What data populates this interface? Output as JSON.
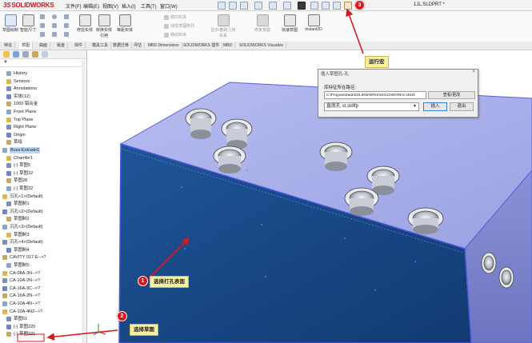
{
  "titlebar": {
    "brand": "SOLIDWORKS",
    "menus": [
      "文件(F)",
      "编辑(E)",
      "视图(V)",
      "插入(I)",
      "工具(T)",
      "窗口(W)"
    ],
    "document_title": "1JL.SLDPRT *"
  },
  "ribbon": {
    "buttons": [
      "草图绘制",
      "智能尺寸",
      "转换实体引用",
      "等距实体",
      "修剪实体",
      "显示/删除几何关系",
      "修复草图",
      "快速草图",
      "Instant2D"
    ],
    "small_buttons": [
      "镜向实体",
      "线性草图阵列",
      "移动实体"
    ]
  },
  "tabs": [
    "特征",
    "草图",
    "曲面",
    "钣金",
    "焊件",
    "模具工具",
    "数据迁移",
    "评估",
    "MBD Dimensions",
    "SOLIDWORKS 插件",
    "MBD",
    "SOLIDWORKS Visualize"
  ],
  "tree": {
    "filter_icon": "filter-icon",
    "items": [
      {
        "label": "History",
        "indent": 1
      },
      {
        "label": "Sensors",
        "indent": 1
      },
      {
        "label": "Annotations",
        "indent": 1
      },
      {
        "label": "实体(12)",
        "indent": 1
      },
      {
        "label": "1060 铝合金",
        "indent": 1
      },
      {
        "label": "Front Plane",
        "indent": 1
      },
      {
        "label": "Top Plane",
        "indent": 1
      },
      {
        "label": "Right Plane",
        "indent": 1
      },
      {
        "label": "Origin",
        "indent": 1
      },
      {
        "label": "草绘",
        "indent": 1
      },
      {
        "label": "Boss-Extrude1",
        "indent": 0,
        "selected": true
      },
      {
        "label": "Chamfer1",
        "indent": 1
      },
      {
        "label": "(-) 草图5",
        "indent": 1
      },
      {
        "label": "(-) 草图32",
        "indent": 1
      },
      {
        "label": "草图28",
        "indent": 1
      },
      {
        "label": "(-) 草图32",
        "indent": 1
      },
      {
        "label": "沉孔<1>(Default)",
        "indent": 0
      },
      {
        "label": "草图制1",
        "indent": 1
      },
      {
        "label": "沉孔<2>(Default)",
        "indent": 0
      },
      {
        "label": "草图制2",
        "indent": 1
      },
      {
        "label": "沉孔<3>(Default)",
        "indent": 0
      },
      {
        "label": "草图制3",
        "indent": 1
      },
      {
        "label": "沉孔<4>(Default)",
        "indent": 0
      },
      {
        "label": "草图制4",
        "indent": 1
      },
      {
        "label": "CAVITY 017-E-->?",
        "indent": 0
      },
      {
        "label": "草图制5",
        "indent": 1
      },
      {
        "label": "CA-08A-3N-->?",
        "indent": 0
      },
      {
        "label": "CA-10A-2N-->?",
        "indent": 0
      },
      {
        "label": "CA-16A-3C-->?",
        "indent": 0
      },
      {
        "label": "CA-16A-2N-->?",
        "indent": 0
      },
      {
        "label": "CA-10A-4N-->?",
        "indent": 0
      },
      {
        "label": "CA-10A-4N2-->?",
        "indent": 0
      },
      {
        "label": "草图51",
        "indent": 1
      },
      {
        "label": "(-) 草图220",
        "indent": 1
      },
      {
        "label": "(-) 草图221",
        "indent": 1,
        "highlight": true
      }
    ]
  },
  "dialog": {
    "title": "插入草图孔-孔",
    "close": "×",
    "label": "库特征所在路径:",
    "path": "C:\\ProgramData\\SOLIDWORKS\\SOLIDWORKS 2018\\",
    "browse": "查看/更改",
    "selected_value": "直底孔 st.sldlfp",
    "insert": "插入",
    "exit": "退出"
  },
  "callouts": {
    "step1": {
      "number": "1",
      "text": "选择打孔表面"
    },
    "step2": {
      "number": "2",
      "text": "选择草图"
    },
    "step3": {
      "number": "3",
      "text": "运行宏"
    }
  },
  "colors": {
    "part_face": "#1c4a8a",
    "part_top": "#a7aee8",
    "part_edge": "#5b5fd6",
    "callout_fill": "#f7f1a5",
    "badge": "#d6191e",
    "arrow": "#d6191e",
    "brand": "#c8161d"
  }
}
